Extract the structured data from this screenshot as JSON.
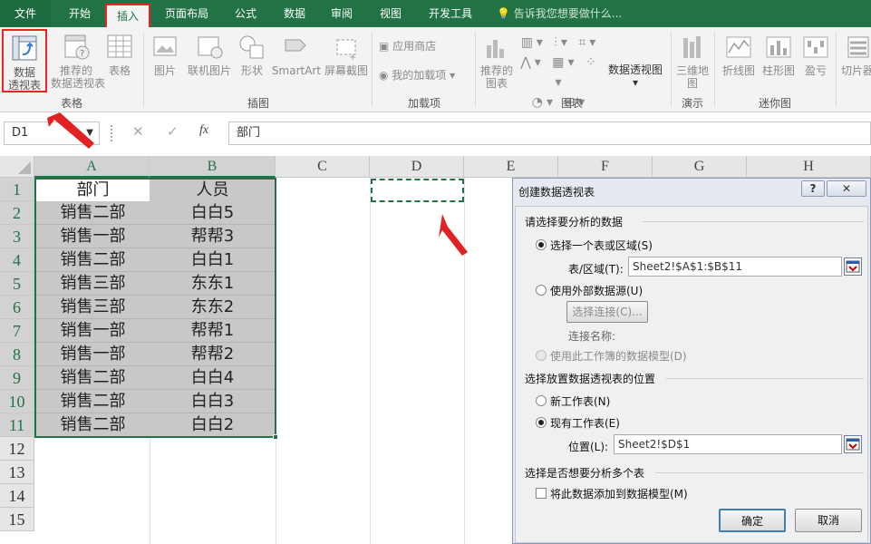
{
  "tabs": [
    "文件",
    "开始",
    "插入",
    "页面布局",
    "公式",
    "数据",
    "审阅",
    "视图",
    "开发工具"
  ],
  "tell_me": "告诉我您想要做什么...",
  "ribbon": {
    "pivot_table": "数据\n透视表",
    "recommended_pivot": "推荐的\n数据透视表",
    "table": "表格",
    "group_tables": "表格",
    "pictures": "图片",
    "online_pictures": "联机图片",
    "shapes": "形状",
    "smartart": "SmartArt",
    "screenshot": "屏幕截图",
    "group_illustrations": "插图",
    "store": "应用商店",
    "my_addins": "我的加载项",
    "group_addins": "加载项",
    "recommended_charts": "推荐的\n图表",
    "pivot_chart": "数据透视图",
    "group_charts": "图表",
    "map_3d": "三维地\n图",
    "group_tours": "演示",
    "line": "折线图",
    "column": "柱形图",
    "win_loss": "盈亏",
    "group_sparklines": "迷你图",
    "slicer": "切片器"
  },
  "formula_bar": {
    "name_box": "D1",
    "content": "部门"
  },
  "columns": [
    "A",
    "B",
    "C",
    "D",
    "E",
    "F",
    "G",
    "H"
  ],
  "rows": [
    "1",
    "2",
    "3",
    "4",
    "5",
    "6",
    "7",
    "8",
    "9",
    "10",
    "11",
    "12",
    "13",
    "14",
    "15"
  ],
  "table": {
    "headers": [
      "部门",
      "人员"
    ],
    "data": [
      [
        "销售二部",
        "白白5"
      ],
      [
        "销售一部",
        "帮帮3"
      ],
      [
        "销售二部",
        "白白1"
      ],
      [
        "销售三部",
        "东东1"
      ],
      [
        "销售三部",
        "东东2"
      ],
      [
        "销售一部",
        "帮帮1"
      ],
      [
        "销售一部",
        "帮帮2"
      ],
      [
        "销售二部",
        "白白4"
      ],
      [
        "销售二部",
        "白白3"
      ],
      [
        "销售二部",
        "白白2"
      ]
    ]
  },
  "dialog": {
    "title": "创建数据透视表",
    "help": "?",
    "close": "✕",
    "section1": "请选择要分析的数据",
    "opt_range": "选择一个表或区域(S)",
    "range_label": "表/区域(T):",
    "range_value": "Sheet2!$A$1:$B$11",
    "opt_external": "使用外部数据源(U)",
    "choose_conn": "选择连接(C)...",
    "conn_name": "连接名称:",
    "opt_datamodel": "使用此工作簿的数据模型(D)",
    "section2": "选择放置数据透视表的位置",
    "opt_new": "新工作表(N)",
    "opt_existing": "现有工作表(E)",
    "location_label": "位置(L):",
    "location_value": "Sheet2!$D$1",
    "section3": "选择是否想要分析多个表",
    "add_model": "将此数据添加到数据模型(M)",
    "ok": "确定",
    "cancel": "取消"
  },
  "colors": {
    "accent": "#217346",
    "annotation": "#e22222"
  }
}
